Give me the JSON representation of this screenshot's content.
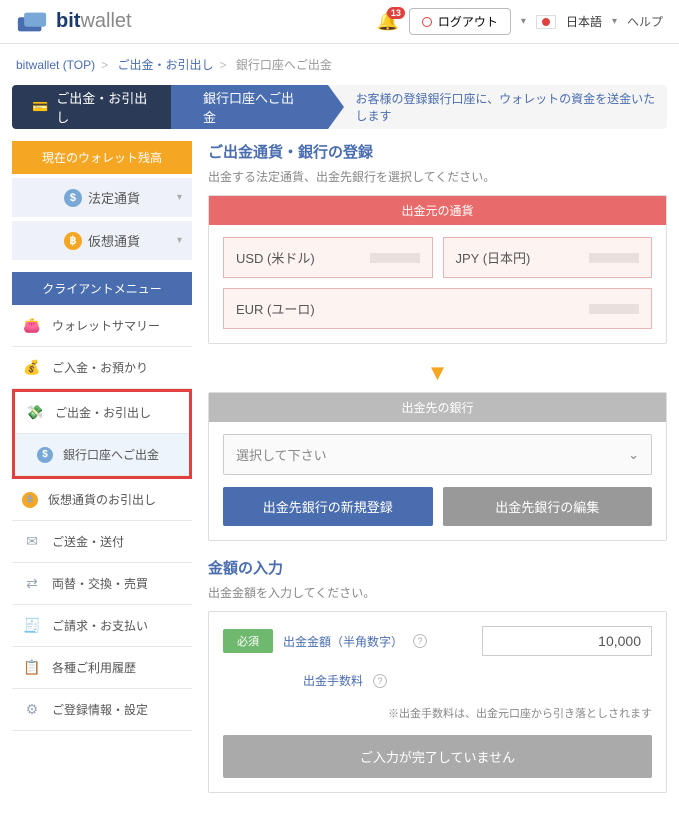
{
  "header": {
    "brand_a": "bit",
    "brand_b": "wallet",
    "notif_count": "13",
    "logout": "ログアウト",
    "lang": "日本語",
    "help": "ヘルプ"
  },
  "breadcrumb": {
    "top": "bitwallet (TOP)",
    "l1": "ご出金・お引出し",
    "l2": "銀行口座へご出金"
  },
  "banner": {
    "dark": "ご出金・お引出し",
    "blue": "銀行口座へご出金",
    "text": "お客様の登録銀行口座に、ウォレットの資金を送金いたします"
  },
  "sidebar": {
    "balance_title": "現在のウォレット残高",
    "fiat": "法定通貨",
    "crypto": "仮想通貨",
    "menu_title": "クライアントメニュー",
    "items": {
      "summary": "ウォレットサマリー",
      "deposit": "ご入金・お預かり",
      "withdraw": "ご出金・お引出し",
      "withdraw_bank": "銀行口座へご出金",
      "withdraw_crypto": "仮想通貨のお引出し",
      "send": "ご送金・送付",
      "exchange": "両替・交換・売買",
      "invoice": "ご請求・お支払い",
      "history": "各種ご利用履歴",
      "settings": "ご登録情報・設定"
    }
  },
  "main": {
    "sec1_title": "ご出金通貨・銀行の登録",
    "sec1_sub": "出金する法定通貨、出金先銀行を選択してください。",
    "src_hdr": "出金元の通貨",
    "currencies": {
      "usd": "USD (米ドル)",
      "jpy": "JPY (日本円)",
      "eur": "EUR (ユーロ)"
    },
    "dest_hdr": "出金先の銀行",
    "select_placeholder": "選択して下さい",
    "btn_new": "出金先銀行の新規登録",
    "btn_edit": "出金先銀行の編集",
    "sec2_title": "金額の入力",
    "sec2_sub": "出金金額を入力してください。",
    "required": "必須",
    "amount_label": "出金金額（半角数字）",
    "amount_value": "10,000",
    "fee_label": "出金手数料",
    "fee_note": "※出金手数料は、出金元口座から引き落としされます",
    "submit": "ご入力が完了していません"
  }
}
